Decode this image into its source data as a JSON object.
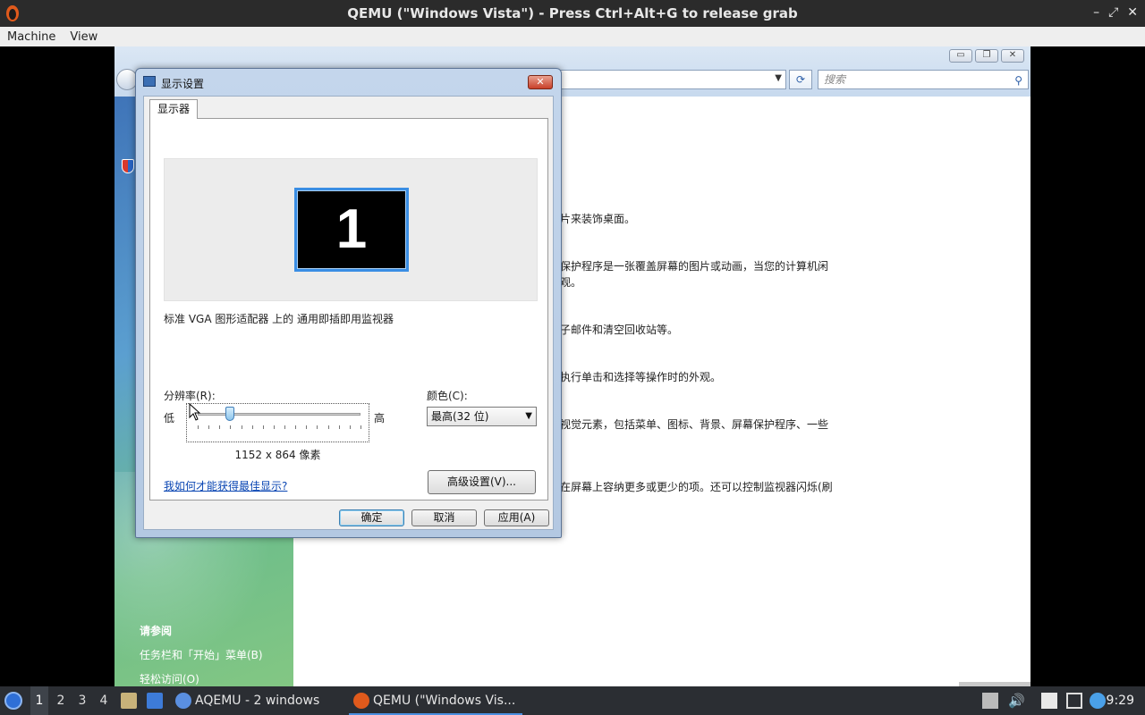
{
  "host": {
    "title": "QEMU (\"Windows Vista\") - Press Ctrl+Alt+G to release grab",
    "menu": [
      "Machine",
      "View"
    ],
    "controls": [
      "–",
      "⤢",
      "✕"
    ]
  },
  "guest": {
    "search_placeholder": "搜索",
    "descriptions": [
      "片来装饰桌面。",
      "保护程序是一张覆盖屏幕的图片或动画，当您的计算机闲",
      "观。",
      "子邮件和清空回收站等。",
      "执行单击和选择等操作时的外观。",
      "视觉元素，包括菜单、图标、背景、屏幕保护程序、一些",
      "在屏幕上容纳更多或更少的项。还可以控制监视器闪烁(刷"
    ],
    "see_also": {
      "header": "请参阅",
      "items": [
        "任务栏和「开始」菜单(B)",
        "轻松访问(O)"
      ]
    }
  },
  "dialog": {
    "title": "显示设置",
    "close": "✕",
    "tab": "显示器",
    "monitor_number": "1",
    "device_label": "标准 VGA 图形适配器 上的 通用即插即用监视器",
    "resolution_label": "分辨率(R):",
    "low": "低",
    "high": "高",
    "resolution_value": "1152 x 864 像素",
    "slider_fraction": 0.2,
    "color_label": "颜色(C):",
    "color_value": "最高(32 位)",
    "help_link": "我如何才能获得最佳显示?",
    "advanced_button": "高级设置(V)...",
    "ok": "确定",
    "cancel": "取消",
    "apply": "应用(A)"
  },
  "taskbar": {
    "workspaces": [
      "1",
      "2",
      "3",
      "4"
    ],
    "tasks": [
      "AQEMU - 2 windows",
      "QEMU (\"Windows Vis..."
    ],
    "clock": "9:29"
  }
}
